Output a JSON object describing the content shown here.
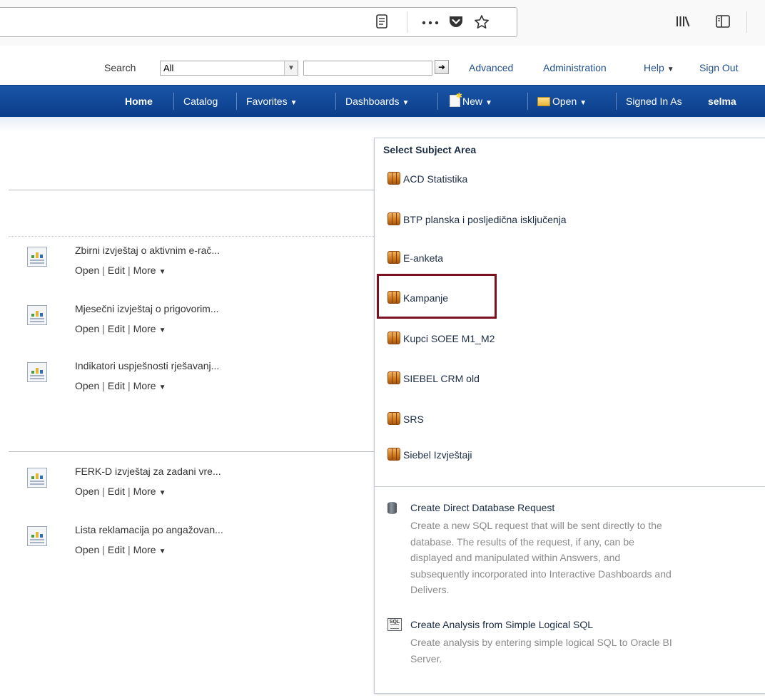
{
  "browser": {
    "icons": [
      "reader-mode-icon",
      "page-actions-icon",
      "pocket-icon",
      "bookmark-star-icon",
      "library-icon",
      "sidebar-icon"
    ]
  },
  "header": {
    "search_label": "Search",
    "search_scope": "All",
    "search_value": "",
    "links": {
      "advanced": "Advanced",
      "administration": "Administration",
      "help": "Help",
      "sign_out": "Sign Out"
    }
  },
  "nav": {
    "home": "Home",
    "catalog": "Catalog",
    "favorites": "Favorites",
    "dashboards": "Dashboards",
    "new": "New",
    "open": "Open",
    "signed_in_label": "Signed In As",
    "user": "selma"
  },
  "documents": [
    {
      "title": "Zbirni izvještaj o aktivnim e-rač...",
      "open": "Open",
      "edit": "Edit",
      "more": "More"
    },
    {
      "title": "Mjesečni izvještaj o prigovorim...",
      "open": "Open",
      "edit": "Edit",
      "more": "More"
    },
    {
      "title": "Indikatori uspješnosti rješavanj...",
      "open": "Open",
      "edit": "Edit",
      "more": "More"
    },
    {
      "title": "FERK-D izvještaj za zadani vre...",
      "open": "Open",
      "edit": "Edit",
      "more": "More"
    },
    {
      "title": "Lista reklamacija po angažovan...",
      "open": "Open",
      "edit": "Edit",
      "more": "More"
    }
  ],
  "popup": {
    "title": "Select Subject Area",
    "subject_areas": [
      "ACD Statistika",
      "BTP planska i posljedična isključenja",
      "E-anketa",
      "Kampanje",
      "Kupci SOEE M1_M2",
      "SIEBEL CRM old",
      "SRS",
      "Siebel Izvještaji"
    ],
    "highlighted": "Kampanje",
    "options": [
      {
        "title": "Create Direct Database Request",
        "desc_lines": [
          "Create a new SQL request that will be sent directly to the",
          "database. The results of the request, if any, can be",
          "displayed and manipulated within Answers, and",
          "subsequently incorporated into Interactive Dashboards and",
          "Delivers."
        ]
      },
      {
        "title": "Create Analysis from Simple Logical SQL",
        "desc_lines": [
          "Create analysis by entering simple logical SQL to Oracle BI",
          "Server."
        ]
      }
    ]
  },
  "colors": {
    "nav_bg": "#0a3d8a",
    "highlight_border": "#7a1020",
    "link": "#1f4e8c"
  }
}
